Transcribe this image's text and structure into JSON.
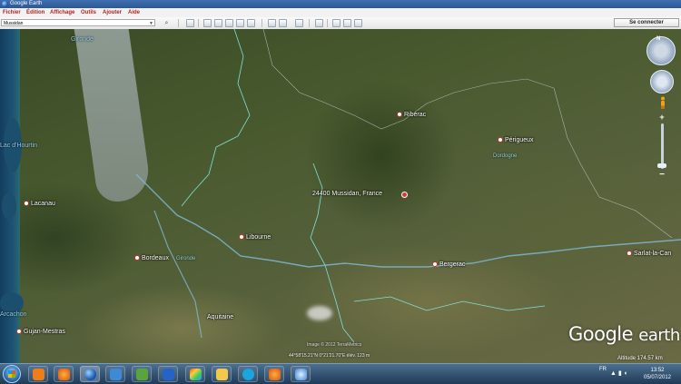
{
  "window": {
    "title": "Google Earth"
  },
  "menu": [
    "Fichier",
    "Édition",
    "Affichage",
    "Outils",
    "Ajouter",
    "Aide"
  ],
  "toolbar": {
    "search_value": "Mussidan",
    "signin_label": "Se connecter",
    "buttons": [
      "sidebar-toggle",
      "placemark",
      "polygon",
      "path",
      "image-overlay",
      "record-tour",
      "historical-imagery",
      "sunlight",
      "planets",
      "ruler",
      "email",
      "print",
      "view-in-maps"
    ]
  },
  "map": {
    "places": [
      {
        "name": "Ribérac"
      },
      {
        "name": "Périgueux"
      },
      {
        "name": "Lacanau"
      },
      {
        "name": "Libourne"
      },
      {
        "name": "Bordeaux"
      },
      {
        "name": "Bergerac"
      },
      {
        "name": "Sarlat-la-Can"
      },
      {
        "name": "Gujan-Mestras"
      },
      {
        "name": "Aquitaine"
      }
    ],
    "regions": [
      "Dordogne",
      "Gironde"
    ],
    "water_labels": [
      "Gironde",
      "Lac d'Hourtin",
      "Arcachon"
    ],
    "marker": {
      "label": "24400 Mussidan, France"
    },
    "status_coords": "44°58'15.21\"N   0°21'21.70\"E  élév.  123 m",
    "imagery_credit": "Image © 2012 TerraMetrics",
    "altitude": "Altitude  174.57 km",
    "logo_main": "Google",
    "logo_sub": "earth"
  },
  "taskbar": {
    "apps": [
      "avast-icon",
      "firefox-icon",
      "google-earth-icon",
      "windows-live-icon",
      "image-viewer-icon",
      "app-icon",
      "paint-icon",
      "folder-icon",
      "skype-icon",
      "firefox-icon-2",
      "itunes-icon"
    ],
    "lang": "FR",
    "time": "13:52",
    "date": "05/07/2012"
  }
}
